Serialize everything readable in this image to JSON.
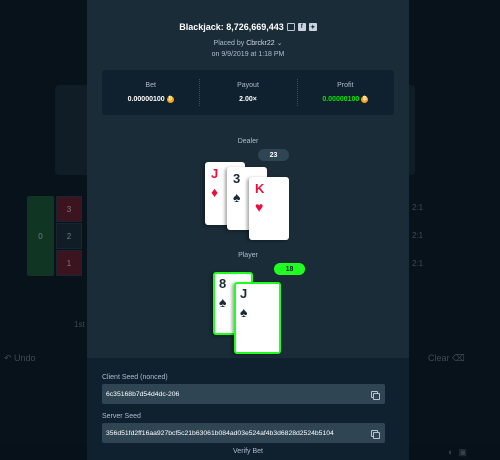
{
  "background": {
    "cells": [
      "3",
      "2",
      "1"
    ],
    "left_cell": "0",
    "right_labels": [
      "2:1",
      "2:1",
      "2:1"
    ],
    "row_label": "1st",
    "undo_label": "Undo",
    "clear_label": "Clear"
  },
  "modal": {
    "title": "Blackjack: 8,726,669,443",
    "placed_by_prefix": "Placed by",
    "username": "Cbrckr22",
    "date": "on 9/9/2019 at 1:18 PM",
    "stats": {
      "bet_label": "Bet",
      "bet_value": "0.00000100",
      "payout_label": "Payout",
      "payout_value": "2.00×",
      "profit_label": "Profit",
      "profit_value": "0.00000100"
    },
    "dealer": {
      "label": "Dealer",
      "score": "23",
      "cards": [
        {
          "rank": "J",
          "suit": "♦",
          "color": "red"
        },
        {
          "rank": "3",
          "suit": "♠",
          "color": "black"
        },
        {
          "rank": "K",
          "suit": "♥",
          "color": "red"
        }
      ]
    },
    "player": {
      "label": "Player",
      "score": "18",
      "cards": [
        {
          "rank": "8",
          "suit": "♠",
          "color": "black"
        },
        {
          "rank": "J",
          "suit": "♠",
          "color": "black"
        }
      ]
    },
    "seeds": {
      "client_label": "Client Seed (nonced)",
      "client_value": "6c35168b7d54d4dc-206",
      "server_label": "Server Seed",
      "server_value": "356d51fd2ff16aa927bcf5c21b63061b084ad03e524af4b3d6828d2524b5104",
      "verify_label": "Verify Bet"
    }
  },
  "colors": {
    "win_green": "#1fff20",
    "profit_green": "#00e701",
    "card_red": "#e9113c",
    "coin": "#f7a418"
  }
}
